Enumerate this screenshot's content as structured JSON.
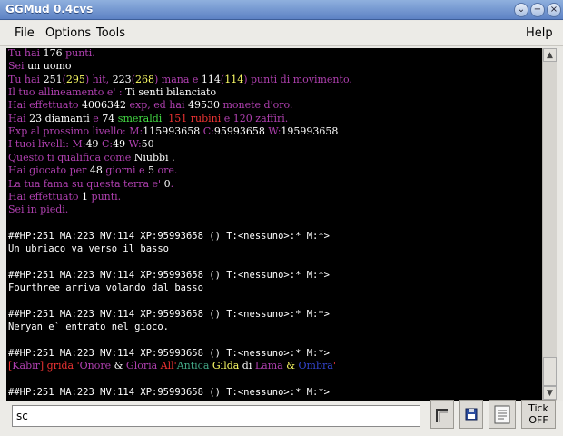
{
  "window": {
    "title": "GGMud 0.4cvs"
  },
  "menu": {
    "file": "File",
    "options": "Options",
    "tools": "Tools",
    "help": "Help"
  },
  "input": {
    "value": "sc"
  },
  "buttons": {
    "tick": "Tick",
    "off": "OFF"
  },
  "terminal_lines": [
    [
      [
        "Tu hai ",
        "#b040b0"
      ],
      [
        "176",
        "#ffffff"
      ],
      [
        " punti.",
        "#b040b0"
      ]
    ],
    [
      [
        "Sei ",
        "#b040b0"
      ],
      [
        "un uomo",
        "#ffffff"
      ]
    ],
    [
      [
        "Tu hai ",
        "#b040b0"
      ],
      [
        "251",
        "#ffffff"
      ],
      [
        "(",
        "#b040b0"
      ],
      [
        "295",
        "#ffff66"
      ],
      [
        ") hit, ",
        "#b040b0"
      ],
      [
        "223",
        "#ffffff"
      ],
      [
        "(",
        "#b040b0"
      ],
      [
        "268",
        "#ffff66"
      ],
      [
        ") mana e ",
        "#b040b0"
      ],
      [
        "114",
        "#ffffff"
      ],
      [
        "(",
        "#b040b0"
      ],
      [
        "114",
        "#ffff66"
      ],
      [
        ") punti di movimento.",
        "#b040b0"
      ]
    ],
    [
      [
        "Il tuo allineamento e' : ",
        "#b040b0"
      ],
      [
        "Ti senti bilanciato",
        "#ffffff"
      ]
    ],
    [
      [
        "Hai effettuato ",
        "#b040b0"
      ],
      [
        "4006342",
        "#ffffff"
      ],
      [
        " exp, ed hai ",
        "#b040b0"
      ],
      [
        "49530",
        "#ffffff"
      ],
      [
        " monete d'oro.",
        "#b040b0"
      ]
    ],
    [
      [
        "Hai ",
        "#b040b0"
      ],
      [
        "23",
        "#ffffff"
      ],
      [
        " diamanti ",
        "#ffffff"
      ],
      [
        "e ",
        "#b040b0"
      ],
      [
        "74",
        "#ffffff"
      ],
      [
        " smeraldi",
        "#44dd44"
      ],
      [
        "  151 rubini",
        "#ee3333"
      ],
      [
        " e 120 zaffiri.",
        "#b040b0"
      ]
    ],
    [
      [
        "Exp al prossimo livello: M:",
        "#b040b0"
      ],
      [
        "115993658",
        "#ffffff"
      ],
      [
        " C:",
        "#b040b0"
      ],
      [
        "95993658",
        "#ffffff"
      ],
      [
        " W:",
        "#b040b0"
      ],
      [
        "195993658",
        "#ffffff"
      ]
    ],
    [
      [
        "I tuoi livelli: M:",
        "#b040b0"
      ],
      [
        "49",
        "#ffffff"
      ],
      [
        " C:",
        "#b040b0"
      ],
      [
        "49",
        "#ffffff"
      ],
      [
        " W:",
        "#b040b0"
      ],
      [
        "50",
        "#ffffff"
      ]
    ],
    [
      [
        "Questo ti qualifica come ",
        "#b040b0"
      ],
      [
        "Niubbi",
        "#ffffff"
      ],
      [
        " .",
        "#ffffff"
      ]
    ],
    [
      [
        "Hai giocato per ",
        "#b040b0"
      ],
      [
        "48",
        "#ffffff"
      ],
      [
        " giorni e ",
        "#b040b0"
      ],
      [
        "5",
        "#ffffff"
      ],
      [
        " ore.",
        "#b040b0"
      ]
    ],
    [
      [
        "La tua fama su questa terra e' ",
        "#b040b0"
      ],
      [
        "0",
        "#ffffff"
      ],
      [
        ".",
        "#b040b0"
      ]
    ],
    [
      [
        "Hai effettuato ",
        "#b040b0"
      ],
      [
        "1",
        "#ffffff"
      ],
      [
        " punti.",
        "#b040b0"
      ]
    ],
    [
      [
        "Sei in piedi.",
        "#b040b0"
      ]
    ],
    [
      [
        "",
        ""
      ]
    ],
    [
      [
        "##HP:251 MA:223 MV:114 XP:95993658 () T:<nessuno>:* M:*>",
        "#ffffff"
      ]
    ],
    [
      [
        "Un ubriaco va verso il basso",
        "#ffffff"
      ]
    ],
    [
      [
        "",
        ""
      ]
    ],
    [
      [
        "##HP:251 MA:223 MV:114 XP:95993658 () T:<nessuno>:* M:*>",
        "#ffffff"
      ]
    ],
    [
      [
        "Fourthree arriva volando dal basso",
        "#ffffff"
      ]
    ],
    [
      [
        "",
        ""
      ]
    ],
    [
      [
        "##HP:251 MA:223 MV:114 XP:95993658 () T:<nessuno>:* M:*>",
        "#ffffff"
      ]
    ],
    [
      [
        "Neryan e` entrato nel gioco.",
        "#ffffff"
      ]
    ],
    [
      [
        "",
        ""
      ]
    ],
    [
      [
        "##HP:251 MA:223 MV:114 XP:95993658 () T:<nessuno>:* M:*>",
        "#ffffff"
      ]
    ],
    [
      [
        "[",
        "#ee3333"
      ],
      [
        "Kabir",
        "#b040b0"
      ],
      [
        "] grida '",
        "#ee3333"
      ],
      [
        "Onore",
        "#b040b0"
      ],
      [
        " & ",
        "#ffffff"
      ],
      [
        "Gloria",
        "#b040b0"
      ],
      [
        " All'",
        "#ee3333"
      ],
      [
        "Antica",
        "#44aa88"
      ],
      [
        " Gilda",
        "#ffff66"
      ],
      [
        " di ",
        "#ffffff"
      ],
      [
        "Lama",
        "#b040b0"
      ],
      [
        " & ",
        "#ffff66"
      ],
      [
        "Ombra",
        "#3344cc"
      ],
      [
        "'",
        "#ee3333"
      ]
    ],
    [
      [
        "",
        ""
      ]
    ],
    [
      [
        "##HP:251 MA:223 MV:114 XP:95993658 () T:<nessuno>:* M:*>",
        "#ffffff"
      ]
    ]
  ]
}
